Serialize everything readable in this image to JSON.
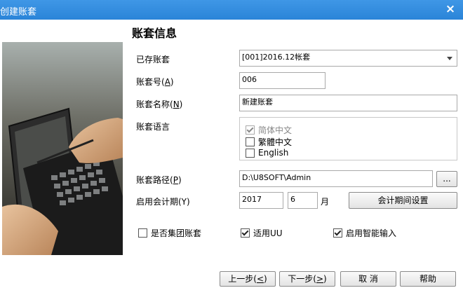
{
  "window": {
    "title": "创建账套",
    "close_glyph": "×"
  },
  "heading": "账套信息",
  "fields": {
    "existing_label": "已存账套",
    "existing_value": "[001]2016.12帐套",
    "number_label_pre": "账套号(",
    "number_label_key": "A",
    "number_label_post": ")",
    "number_value": "006",
    "name_label_pre": "账套名称(",
    "name_label_key": "N",
    "name_label_post": ")",
    "name_value": "新建账套",
    "language_label": "账套语言",
    "path_label_pre": "账套路径(",
    "path_label_key": "P",
    "path_label_post": ")",
    "path_value": "D:\\U8SOFT\\Admin",
    "browse_label": "...",
    "period_label": "启用会计期(Y)",
    "year_value": "2017",
    "month_value": "6",
    "month_unit": "月",
    "period_settings_button": "会计期间设置"
  },
  "languages": [
    {
      "label": "简体中文",
      "checked": true,
      "disabled": true
    },
    {
      "label": "繁體中文",
      "checked": false,
      "disabled": false
    },
    {
      "label": "English",
      "checked": false,
      "disabled": false
    }
  ],
  "options": [
    {
      "label": "是否集团账套",
      "checked": false
    },
    {
      "label": "适用UU",
      "checked": true
    },
    {
      "label": "启用智能输入",
      "checked": true
    }
  ],
  "buttons": {
    "prev_pre": "上一步(",
    "prev_key": "<",
    "prev_post": ")",
    "next_pre": "下一步(",
    "next_key": ">",
    "next_post": ")",
    "cancel": "取 消",
    "help": "帮助"
  }
}
